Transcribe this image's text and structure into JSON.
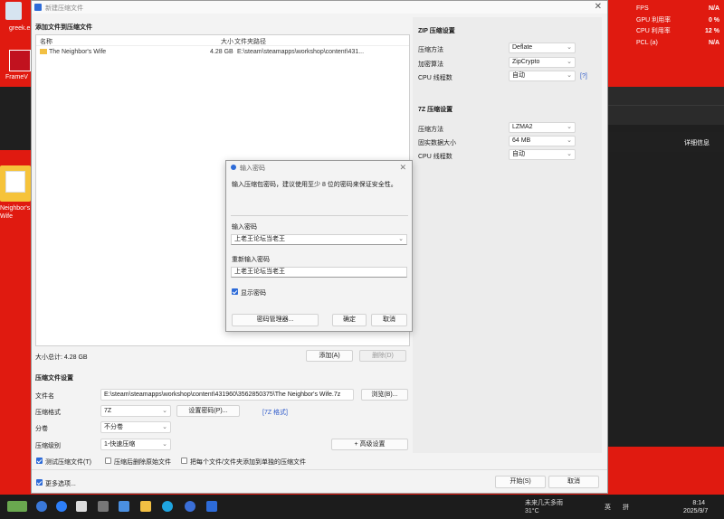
{
  "desktop": {
    "greek_label": "greek.e",
    "framev_label": "FrameV",
    "folder_label": "Neighbor's\nWife"
  },
  "osd": {
    "rows": [
      {
        "label": "FPS",
        "value": "N/A"
      },
      {
        "label": "GPU 利用率",
        "value": "0 %"
      },
      {
        "label": "CPU 利用率",
        "value": "12 %"
      },
      {
        "label": "PCL (a)",
        "value": "N/A"
      }
    ]
  },
  "bg_window": {
    "detail_info": "详细信息"
  },
  "dialog": {
    "title": "新建压缩文件",
    "add_files_title": "添加文件到压缩文件",
    "columns": {
      "name": "名称",
      "size": "大小",
      "path": "文件夹路径"
    },
    "files": [
      {
        "name": "The Neighbor's Wife",
        "size": "4.28 GB",
        "path": "E:\\steam\\steamapps\\workshop\\content\\431..."
      }
    ],
    "total": "大小总计: 4.28 GB",
    "add_button": "添加(A)",
    "delete_button": "删除(D)",
    "archive_settings_title": "压缩文件设置",
    "filename_label": "文件名",
    "filename_value": "E:\\steam\\steamapps\\workshop\\content\\431960\\3562850375\\The Neighbor's Wife.7z",
    "browse_button": "浏览(B)...",
    "format_label": "压缩格式",
    "format_value": "7Z",
    "set_password_button": "设置密码(P)...",
    "format_link": "[7Z 格式]",
    "split_label": "分卷",
    "split_value": "不分卷",
    "level_label": "压缩级别",
    "level_value": "1-快速压缩",
    "advanced_button": "+ 高级设置",
    "test_archive": "测试压缩文件(T)",
    "delete_after": "压缩后删除原始文件",
    "separate_archives": "把每个文件/文件夹添加到单独的压缩文件",
    "more_options": "更多选项...",
    "start_button": "开始(S)",
    "cancel_button": "取消"
  },
  "zip_settings": {
    "title": "ZIP 压缩设置",
    "method_label": "压缩方法",
    "method_value": "Deflate",
    "encrypt_label": "加密算法",
    "encrypt_value": "ZipCrypto",
    "threads_label": "CPU 线程数",
    "threads_value": "自动",
    "help": "[?]"
  },
  "sevenz_settings": {
    "title": "7Z 压缩设置",
    "method_label": "压缩方法",
    "method_value": "LZMA2",
    "solid_label": "固实数据大小",
    "solid_value": "64 MB",
    "threads_label": "CPU 线程数",
    "threads_value": "自动"
  },
  "password_dialog": {
    "title": "输入密码",
    "hint": "输入压缩包密码，建议使用至少 8 位的密码来保证安全性。",
    "enter_label": "输入密码",
    "enter_value": "上老王论坛当老王",
    "reenter_label": "重新输入密码",
    "reenter_value": "上老王论坛当老王",
    "show_password": "显示密码",
    "manager_button": "密码管理器...",
    "ok_button": "确定",
    "cancel_button": "取消"
  },
  "taskbar": {
    "weather_line1": "未来几天多雨",
    "weather_line2": "31°C",
    "ime_en": "英",
    "ime_pin": "拼",
    "time": "8:14",
    "date": "2025/9/7"
  }
}
